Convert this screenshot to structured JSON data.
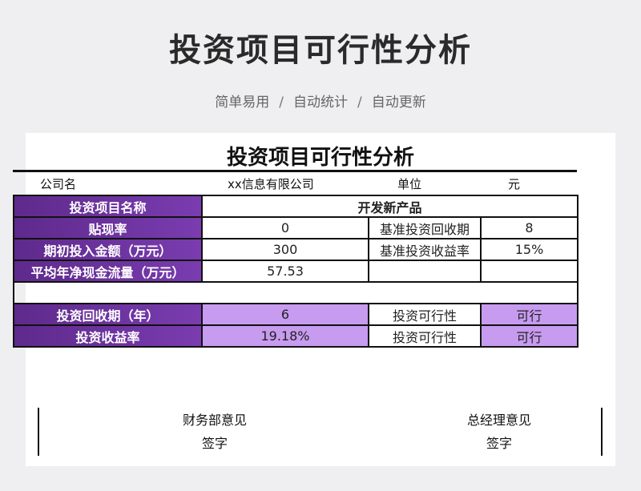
{
  "banner": {
    "title": "投资项目可行性分析",
    "subtitle": [
      "简单易用",
      "自动统计",
      "自动更新"
    ],
    "separator": "/"
  },
  "sheet": {
    "title": "投资项目可行性分析",
    "company_label": "公司名",
    "company_value": "xx信息有限公司",
    "unit_label": "单位",
    "unit_value": "元",
    "project_name_label": "投资项目名称",
    "project_name_value": "开发新产品",
    "discount_rate_label": "贴现率",
    "discount_rate_value": "0",
    "benchmark_payback_label": "基准投资回收期",
    "benchmark_payback_value": "8",
    "initial_investment_label": "期初投入金额（万元）",
    "initial_investment_value": "300",
    "benchmark_return_label": "基准投资收益率",
    "benchmark_return_value": "15%",
    "avg_cashflow_label": "平均年净现金流量（万元）",
    "avg_cashflow_value": "57.53",
    "payback_label": "投资回收期（年）",
    "payback_value": "6",
    "feasibility_label": "投资可行性",
    "payback_feasibility_value": "可行",
    "return_label": "投资收益率",
    "return_value": "19.18%",
    "return_feasibility_value": "可行",
    "finance_opinion": "财务部意见",
    "gm_opinion": "总经理意见",
    "sign_label": "签字"
  },
  "colors": {
    "label_purple": "#6b32a0",
    "highlight_lilac": "#c79bf0"
  }
}
